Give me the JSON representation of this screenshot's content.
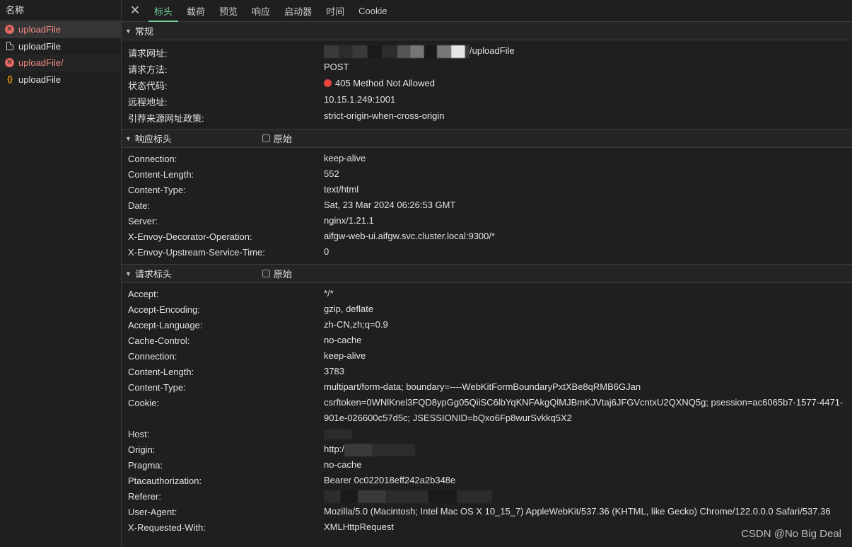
{
  "left": {
    "header": "名称",
    "requests": [
      {
        "name": "uploadFile",
        "icon": "error-icon",
        "error": true
      },
      {
        "name": "uploadFile",
        "icon": "document-icon",
        "error": false
      },
      {
        "name": "uploadFile/",
        "icon": "error-icon",
        "error": true
      },
      {
        "name": "uploadFile",
        "icon": "xhr-icon",
        "error": false
      }
    ]
  },
  "tabs": {
    "close": "✕",
    "items": [
      "标头",
      "载荷",
      "预览",
      "响应",
      "启动器",
      "时间",
      "Cookie"
    ],
    "active": "标头"
  },
  "general": {
    "title": "常规",
    "rows": [
      {
        "key": "请求网址:",
        "value": "/uploadFile"
      },
      {
        "key": "请求方法:",
        "value": "POST"
      },
      {
        "key": "状态代码:",
        "value": "405 Method Not Allowed"
      },
      {
        "key": "远程地址:",
        "value": "10.15.1.249:1001"
      },
      {
        "key": "引荐来源网址政策:",
        "value": "strict-origin-when-cross-origin"
      }
    ]
  },
  "response_headers": {
    "title": "响应标头",
    "raw_label": "原始",
    "rows": [
      {
        "key": "Connection:",
        "value": "keep-alive"
      },
      {
        "key": "Content-Length:",
        "value": "552"
      },
      {
        "key": "Content-Type:",
        "value": "text/html"
      },
      {
        "key": "Date:",
        "value": "Sat, 23 Mar 2024 06:26:53 GMT"
      },
      {
        "key": "Server:",
        "value": "nginx/1.21.1"
      },
      {
        "key": "X-Envoy-Decorator-Operation:",
        "value": "aifgw-web-ui.aifgw.svc.cluster.local:9300/*"
      },
      {
        "key": "X-Envoy-Upstream-Service-Time:",
        "value": "0"
      }
    ]
  },
  "request_headers": {
    "title": "请求标头",
    "raw_label": "原始",
    "rows": [
      {
        "key": "Accept:",
        "value": "*/*"
      },
      {
        "key": "Accept-Encoding:",
        "value": "gzip, deflate"
      },
      {
        "key": "Accept-Language:",
        "value": "zh-CN,zh;q=0.9"
      },
      {
        "key": "Cache-Control:",
        "value": "no-cache"
      },
      {
        "key": "Connection:",
        "value": "keep-alive"
      },
      {
        "key": "Content-Length:",
        "value": "3783"
      },
      {
        "key": "Content-Type:",
        "value": "multipart/form-data; boundary=----WebKitFormBoundaryPxtXBe8qRMB6GJan"
      },
      {
        "key": "Cookie:",
        "value": "csrftoken=0WNlKnel3FQD8ypGg05QiiSC6lbYqKNFAkgQlMJBmKJVtaj6JFGVcntxU2QXNQ5g; psession=ac6065b7-1577-4471-901e-026600c57d5c; JSESSIONID=bQxo6Fp8wurSvkkq5X2"
      },
      {
        "key": "Host:",
        "value": ""
      },
      {
        "key": "Origin:",
        "value": "http:/"
      },
      {
        "key": "Pragma:",
        "value": "no-cache"
      },
      {
        "key": "Ptacauthorization:",
        "value": "Bearer 0c022018eff242a2b348e"
      },
      {
        "key": "Referer:",
        "value": ""
      },
      {
        "key": "User-Agent:",
        "value": "Mozilla/5.0 (Macintosh; Intel Mac OS X 10_15_7) AppleWebKit/537.36 (KHTML, like Gecko) Chrome/122.0.0.0 Safari/537.36"
      },
      {
        "key": "X-Requested-With:",
        "value": "XMLHttpRequest"
      }
    ]
  },
  "watermark": "CSDN @No Big Deal",
  "colors": {
    "error": "#e8453c",
    "active_tab": "#6fcf97",
    "background": "#1f1f1f"
  }
}
